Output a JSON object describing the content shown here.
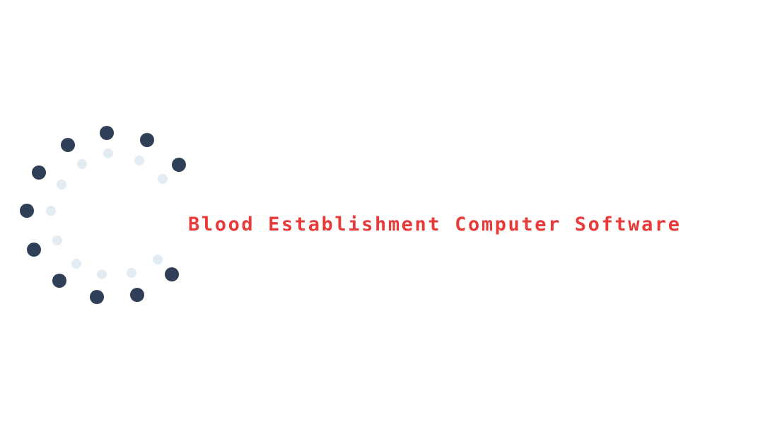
{
  "brand": {
    "name": "Blood Establishment Computer Software",
    "text_color": "#e93a3a"
  },
  "logo_mark": {
    "icon": "dotted-circle-logo-icon",
    "outer_dot_color": "#2f3f58",
    "inner_dot_color": "#e2ecf3"
  }
}
